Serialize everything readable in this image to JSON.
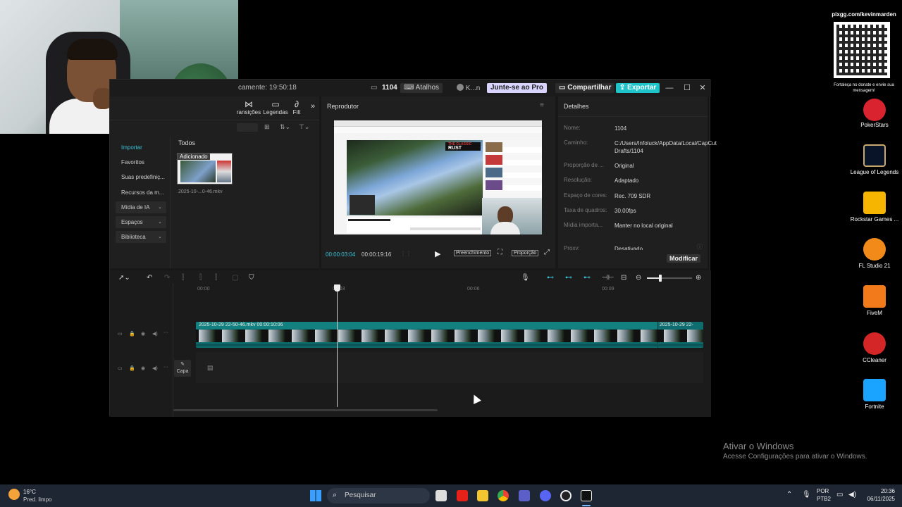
{
  "app": {
    "title_autosave": "camente: 19:50:18",
    "project_name": "1104",
    "shortcuts_label": "Atalhos",
    "user_label": "K...n",
    "pro_label": "Junte-se ao Pro",
    "share_label": "Compartilhar",
    "export_label": "Exportar",
    "minimize": "—",
    "maximize": "☐",
    "close": "✕"
  },
  "toolbar": {
    "transitions": "ransições",
    "captions": "Legendas",
    "filters": "Filt"
  },
  "sidebar": {
    "items": [
      {
        "label": "Importar"
      },
      {
        "label": "Favoritos"
      },
      {
        "label": "Suas predefiniç..."
      },
      {
        "label": "Recursos da m..."
      },
      {
        "label": "Mídia de IA"
      },
      {
        "label": "Espaços"
      },
      {
        "label": "Biblioteca"
      }
    ]
  },
  "media": {
    "tab_all": "Todos",
    "clip_badge": "Adicionado",
    "clip_name": "2025-10-...0-46.mkv"
  },
  "player": {
    "title": "Reprodutor",
    "current_time": "00:00:03:04",
    "total_time": "00:00:19:16",
    "fill_label": "Preenchimento",
    "ratio_label": "Proporção",
    "preview_logo_line1": "THE CLASSIC",
    "preview_logo_line2": "RUST"
  },
  "details": {
    "title": "Detalhes",
    "rows": [
      {
        "label": "Nome:",
        "value": "1104"
      },
      {
        "label": "Caminho:",
        "value": "C:/Users/Infoluck/AppData/Local/CapCut Drafts/1104"
      },
      {
        "label": "Proporção de ...",
        "value": "Original"
      },
      {
        "label": "Resolução:",
        "value": "Adaptado"
      },
      {
        "label": "Espaço de cores:",
        "value": "Rec. 709 SDR"
      },
      {
        "label": "Taxa de quadros:",
        "value": "30.00fps"
      },
      {
        "label": "Mídia importa...",
        "value": "Manter no local original"
      },
      {
        "label": "Proxy:",
        "value": "Desativado"
      }
    ],
    "modify_label": "Modificar"
  },
  "timeline": {
    "ticks": [
      "00:00",
      "00:03",
      "00:06",
      "00:09"
    ],
    "clip1_label": "2025-10-29 22-50-46.mkv   00:00:10:06",
    "clip2_label": "2025-10-29 22-",
    "cover_label": "Capa"
  },
  "desktop": {
    "qr_caption_top": "pixgg.com/kevinmarden",
    "qr_caption_bottom": "Fortaleça no donate e envie sua mensagem!",
    "icons": [
      {
        "label": "PokerStars",
        "color": "#d9232e"
      },
      {
        "label": "League of Legends",
        "color": "#0a1428"
      },
      {
        "label": "Rockstar Games ...",
        "color": "#f5b500"
      },
      {
        "label": "FL Studio 21",
        "color": "#f28a1a"
      },
      {
        "label": "FiveM",
        "color": "#f27a1a"
      },
      {
        "label": "CCleaner",
        "color": "#d42626"
      },
      {
        "label": "Fortnite",
        "color": "#1aa3ff"
      }
    ],
    "activate_title": "Ativar o Windows",
    "activate_sub": "Acesse Configurações para ativar o Windows."
  },
  "taskbar": {
    "weather_temp": "16°C",
    "weather_desc": "Pred. limpo",
    "search_placeholder": "Pesquisar",
    "lang_top": "POR",
    "lang_bottom": "PTB2",
    "time": "20:36",
    "date": "06/11/2025"
  }
}
